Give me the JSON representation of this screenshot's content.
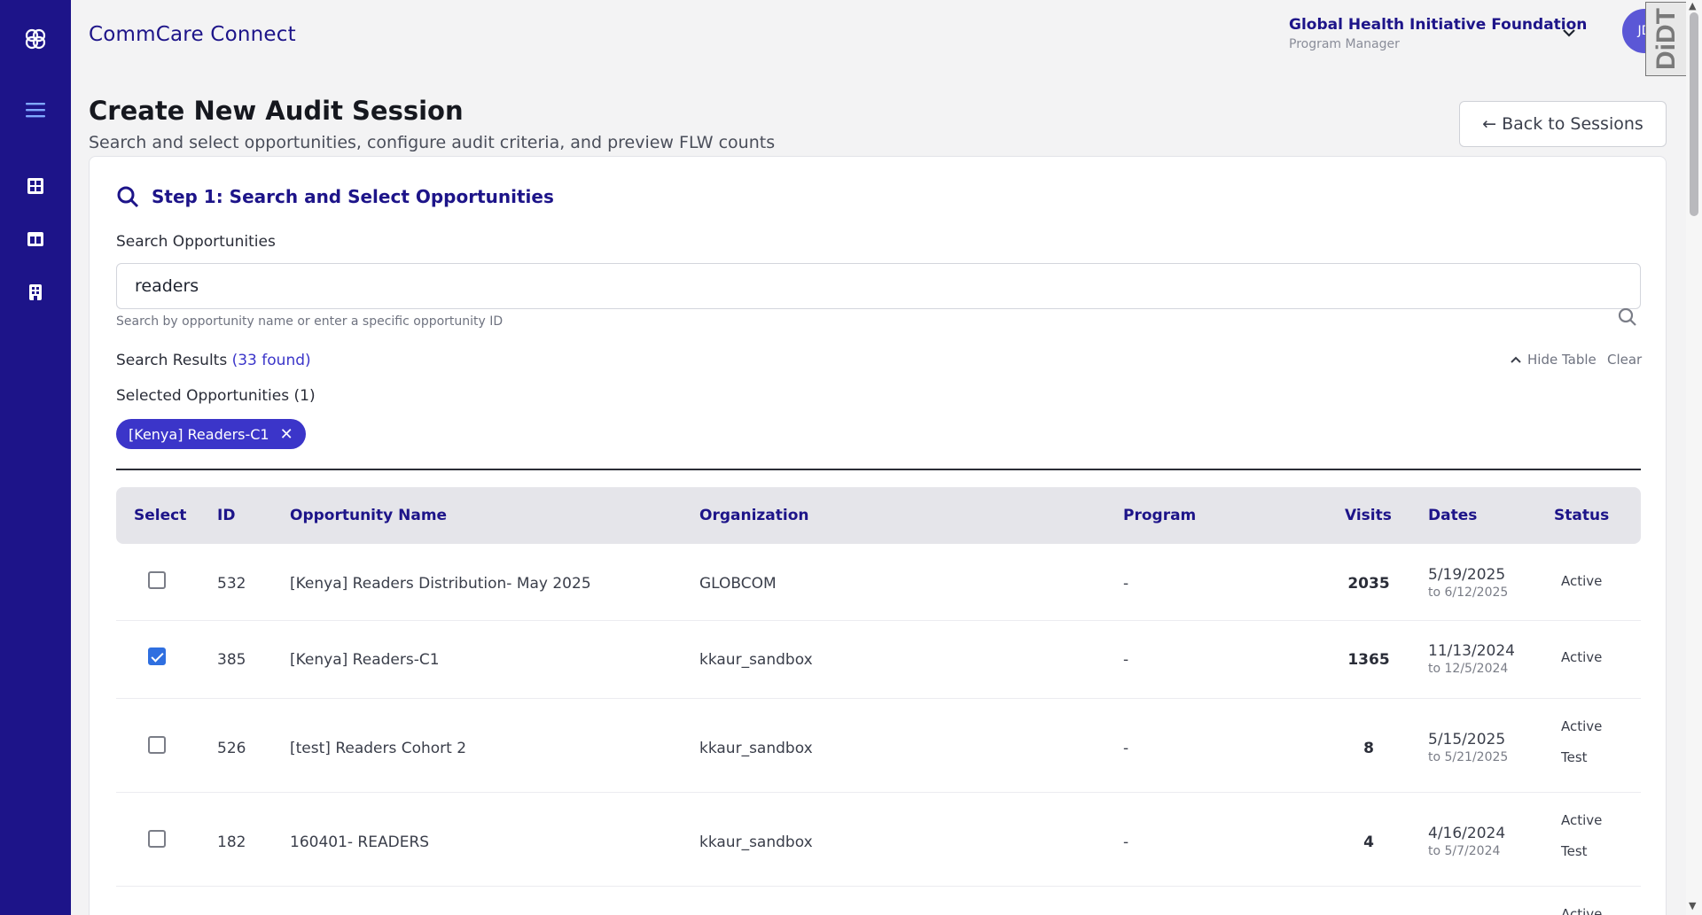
{
  "app": {
    "title": "CommCare Connect"
  },
  "org": {
    "name": "Global Health Initiative Foundation",
    "role": "Program Manager",
    "avatar_initials": "JD"
  },
  "extension": {
    "label": "DiDT"
  },
  "page": {
    "title": "Create New Audit Session",
    "subtitle": "Search and select opportunities, configure audit criteria, and preview FLW counts",
    "back_label": "← Back to Sessions"
  },
  "step1": {
    "title": "Step 1: Search and Select Opportunities",
    "search_label": "Search Opportunities",
    "search_value": "readers",
    "search_hint": "Search by opportunity name or enter a specific opportunity ID",
    "results_label": "Search Results",
    "results_count": "(33 found)",
    "hide_table": "Hide Table",
    "clear": "Clear",
    "selected_label": "Selected Opportunities (1)",
    "selected_chips": [
      "[Kenya] Readers-C1"
    ]
  },
  "table": {
    "headers": [
      "Select",
      "ID",
      "Opportunity Name",
      "Organization",
      "Program",
      "Visits",
      "Dates",
      "Status"
    ],
    "rows": [
      {
        "selected": false,
        "id": "532",
        "name": "[Kenya] Readers Distribution- May 2025",
        "org": "GLOBCOM",
        "program": "-",
        "visits": "2035",
        "date": "5/19/2025",
        "date_to": "to 6/12/2025",
        "status": "Active",
        "tag": ""
      },
      {
        "selected": true,
        "id": "385",
        "name": "[Kenya] Readers-C1",
        "org": "kkaur_sandbox",
        "program": "-",
        "visits": "1365",
        "date": "11/13/2024",
        "date_to": "to 12/5/2024",
        "status": "Active",
        "tag": ""
      },
      {
        "selected": false,
        "id": "526",
        "name": "[test] Readers Cohort 2",
        "org": "kkaur_sandbox",
        "program": "-",
        "visits": "8",
        "date": "5/15/2025",
        "date_to": "to 5/21/2025",
        "status": "Active",
        "tag": "Test"
      },
      {
        "selected": false,
        "id": "182",
        "name": "160401- READERS",
        "org": "kkaur_sandbox",
        "program": "-",
        "visits": "4",
        "date": "4/16/2024",
        "date_to": "to 5/7/2024",
        "status": "Active",
        "tag": "Test"
      }
    ],
    "partial_row_status": "Active"
  },
  "colors": {
    "brand": "#1d1489",
    "accent": "#3b35c9",
    "checkbox": "#2f6fe0"
  },
  "icons": [
    "logo-icon",
    "menu-icon",
    "dashboard-icon",
    "layout-icon",
    "building-icon",
    "search-icon",
    "chevron-down-icon",
    "chevron-up-icon",
    "close-icon"
  ]
}
